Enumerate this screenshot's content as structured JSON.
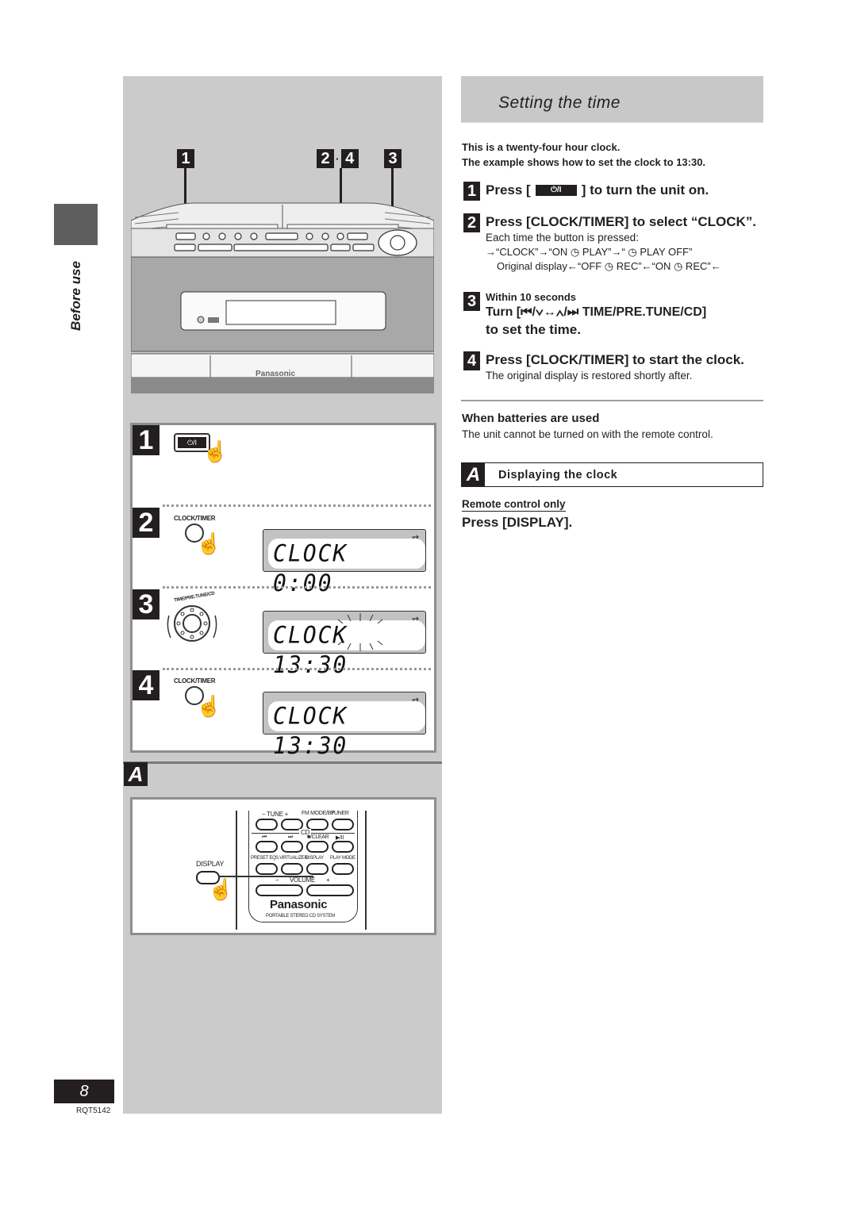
{
  "sidebar": {
    "section_label": "Before use",
    "page_number": "8",
    "doc_code": "RQT5142"
  },
  "illustration": {
    "callouts": [
      "1",
      "2·4",
      "3"
    ],
    "brand": "Panasonic",
    "steps": [
      {
        "number": "1",
        "button_label": "⏻/I"
      },
      {
        "number": "2",
        "button_label": "CLOCK/TIMER",
        "display": "CLOCK  0:00"
      },
      {
        "number": "3",
        "button_label": "TIME/PRE.TUNE/CD",
        "display": "CLOCK 13:30"
      },
      {
        "number": "4",
        "button_label": "CLOCK/TIMER",
        "display": "CLOCK 13:30"
      }
    ],
    "display_icon": "⇄",
    "section_a_marker": "A",
    "remote": {
      "pointer_label": "DISPLAY",
      "row1": [
        "−  TUNE  +",
        "FM MODE/BP",
        "TUNER"
      ],
      "cd_label": "CD",
      "row2": [
        "⏮",
        "⏭",
        "■/CLEAR",
        "▶/II"
      ],
      "row3": [
        "PRESET EQ",
        "S.VIRTUALIZER",
        "DISPLAY",
        "PLAY MODE"
      ],
      "volume": [
        "−",
        "VOLUME",
        "+"
      ],
      "brand": "Panasonic",
      "subtitle": "PORTABLE STEREO CD SYSTEM"
    }
  },
  "content": {
    "title": "Setting the time",
    "intro": [
      "This is a twenty-four hour clock.",
      "The example shows how to set the clock to 13:30."
    ],
    "steps": [
      {
        "number": "1",
        "heading_pre": "Press [",
        "button": "⏻/I",
        "heading_post": "] to turn the unit on."
      },
      {
        "number": "2",
        "heading": "Press [CLOCK/TIMER] to select “CLOCK”.",
        "note": "Each time the button is pressed:",
        "cycle_line1": "→“CLOCK”→“ON  ◷ PLAY”→“ ◷ PLAY OFF”",
        "cycle_line2": "Original display←“OFF ◷ REC”←“ON  ◷ REC”←"
      },
      {
        "number": "3",
        "pre_note": "Within 10 seconds",
        "heading_line1": "Turn [⏮/∨↔∧/⏭ TIME/PRE.TUNE/CD]",
        "heading_line2": "to set the time."
      },
      {
        "number": "4",
        "heading": "Press [CLOCK/TIMER] to start the clock.",
        "note": "The original display is restored shortly after."
      }
    ],
    "batteries": {
      "heading": "When batteries are used",
      "text": "The unit cannot be turned on with the remote control."
    },
    "section_a": {
      "marker": "A",
      "title": "Displaying the clock",
      "subhead": "Remote control only",
      "instruction": "Press [DISPLAY]."
    }
  }
}
